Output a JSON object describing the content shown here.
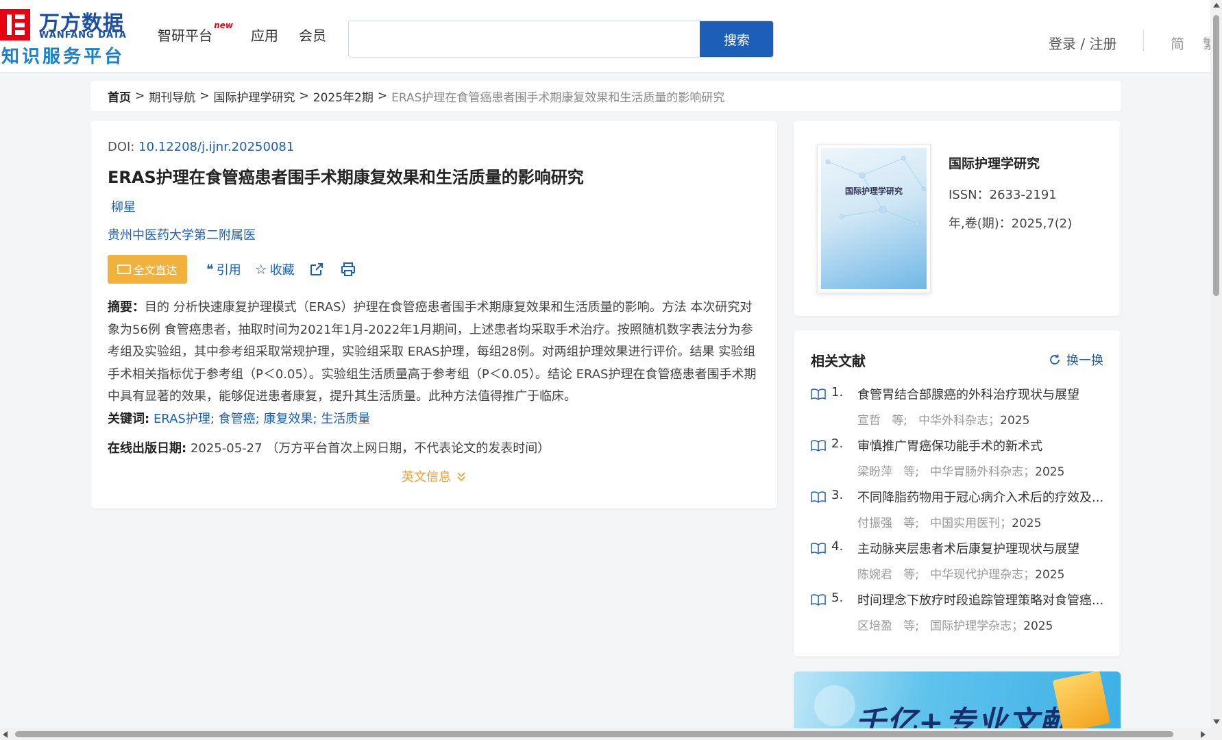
{
  "header": {
    "logo_cn": "万方数据",
    "logo_en": "WANFANG DATA",
    "logo_sub": "知识服务平台",
    "nav": [
      {
        "label": "智研平台",
        "badge": "new"
      },
      {
        "label": "应用"
      },
      {
        "label": "会员"
      }
    ],
    "search": {
      "value": "",
      "placeholder": "",
      "button": "搜索"
    },
    "login": "登录 / 注册",
    "lang_simplified": "简",
    "lang_traditional": "繁"
  },
  "breadcrumb": {
    "home": "首页",
    "items": [
      "期刊导航",
      "国际护理学研究",
      "2025年2期"
    ],
    "current": "ERAS护理在食管癌患者围手术期康复效果和生活质量的影响研究",
    "separator": ">"
  },
  "article": {
    "doi_label": "DOI: ",
    "doi": "10.12208/j.ijnr.20250081",
    "title": "ERAS护理在食管癌患者围手术期康复效果和生活质量的影响研究",
    "author": "柳星",
    "affiliation": "贵州中医药大学第二附属医",
    "actions": {
      "full_text": "全文直达",
      "cite": "引用",
      "favorite": "收藏"
    },
    "abstract_label": "摘要：",
    "abstract": "目的 分析快速康复护理模式（ERAS）护理在食管癌患者围手术期康复效果和生活质量的影响。方法 本次研究对象为56例 食管癌患者，抽取时间为2021年1月-2022年1月期间，上述患者均采取手术治疗。按照随机数字表法分为参考组及实验组，其中参考组采取常规护理，实验组采取 ERAS护理，每组28例。对两组护理效果进行评价。结果 实验组手术相关指标优于参考组（P＜0.05）。实验组生活质量高于参考组（P＜0.05）。结论 ERAS护理在食管癌患者围手术期中具有显著的效果，能够促进患者康复，提升其生活质量。此种方法值得推广于临床。",
    "keywords_label": "关键词:",
    "keywords": [
      "ERAS护理",
      "食管癌",
      "康复效果",
      "生活质量"
    ],
    "pubdate_label": "在线出版日期:",
    "pubdate": "2025-05-27",
    "pubdate_note": "（万方平台首次上网日期，不代表论文的发表时间）",
    "en_toggle": "英文信息"
  },
  "journal": {
    "cover_title": "国际护理学研究",
    "name": "国际护理学研究",
    "issn_label": "ISSN：",
    "issn": "2633-2191",
    "year_label": "年,卷(期)：",
    "year": "2025,7(2)"
  },
  "related": {
    "title": "相关文献",
    "refresh": "换一换",
    "items": [
      {
        "num": "1.",
        "title": "食管胃结合部腺癌的外科治疗现状与展望",
        "author": "宣哲",
        "etc": "等;",
        "journal": "中华外科杂志；",
        "year": "2025"
      },
      {
        "num": "2.",
        "title": "审慎推广胃癌保功能手术的新术式",
        "author": "梁盼萍",
        "etc": "等;",
        "journal": "中华胃肠外科杂志；",
        "year": "2025"
      },
      {
        "num": "3.",
        "title": "不同降脂药物用于冠心病介入术后的疗效及...",
        "author": "付振强",
        "etc": "等;",
        "journal": "中国实用医刊；",
        "year": "2025"
      },
      {
        "num": "4.",
        "title": "主动脉夹层患者术后康复护理现状与展望",
        "author": "陈婉君",
        "etc": "等;",
        "journal": "中华现代护理杂志；",
        "year": "2025"
      },
      {
        "num": "5.",
        "title": "时间理念下放疗时段追踪管理策略对食管癌...",
        "author": "区培盈",
        "etc": "等;",
        "journal": "国际护理学杂志；",
        "year": "2025"
      }
    ]
  },
  "banner": {
    "text": "千亿+专业文献"
  },
  "colors": {
    "brand_blue": "#1b5fb8",
    "logo_red": "#e60012",
    "accent_orange": "#f0b23c"
  }
}
